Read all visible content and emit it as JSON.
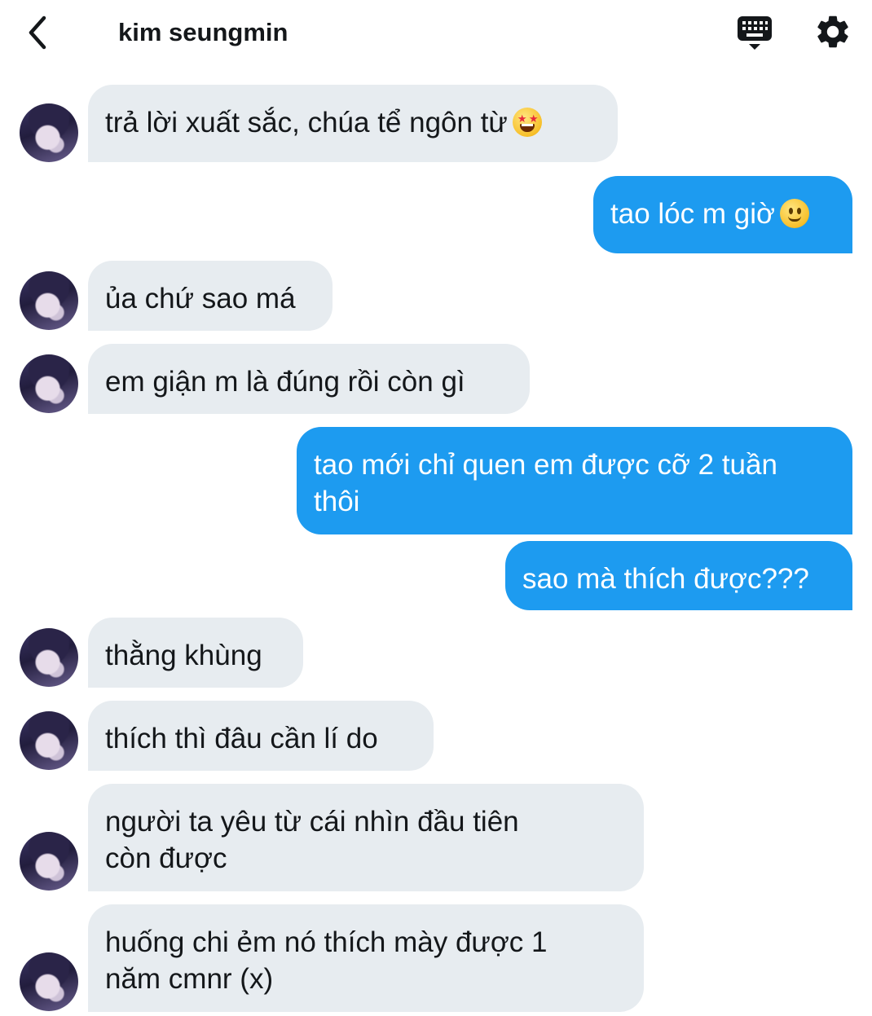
{
  "header": {
    "title": "kim seungmin",
    "back_icon": "chevron-left-icon",
    "keyboard_icon": "keyboard-icon",
    "settings_icon": "gear-icon"
  },
  "colors": {
    "sent_bubble": "#1d9bf0",
    "received_bubble": "#e7ecf0",
    "text_dark": "#14171a"
  },
  "messages": [
    {
      "side": "received",
      "text": "trả lời xuất sắc, chúa tể ngôn từ",
      "emoji": "star-struck"
    },
    {
      "side": "sent",
      "text": "tao lóc m giờ",
      "emoji": "slightly-smiling-face"
    },
    {
      "side": "received",
      "text": "ủa chứ sao má"
    },
    {
      "side": "received",
      "text": "em giận m là đúng rồi còn gì"
    },
    {
      "side": "sent",
      "text": "tao mới chỉ quen em được cỡ 2 tuần\nthôi"
    },
    {
      "side": "sent",
      "text": "sao mà thích được???"
    },
    {
      "side": "received",
      "text": "thằng khùng"
    },
    {
      "side": "received",
      "text": "thích thì đâu cần lí do"
    },
    {
      "side": "received",
      "text": "người ta yêu từ cái nhìn đầu tiên\ncòn được"
    },
    {
      "side": "received",
      "text": "huống chi ẻm nó thích mày được 1\nnăm cmnr (x)"
    }
  ]
}
